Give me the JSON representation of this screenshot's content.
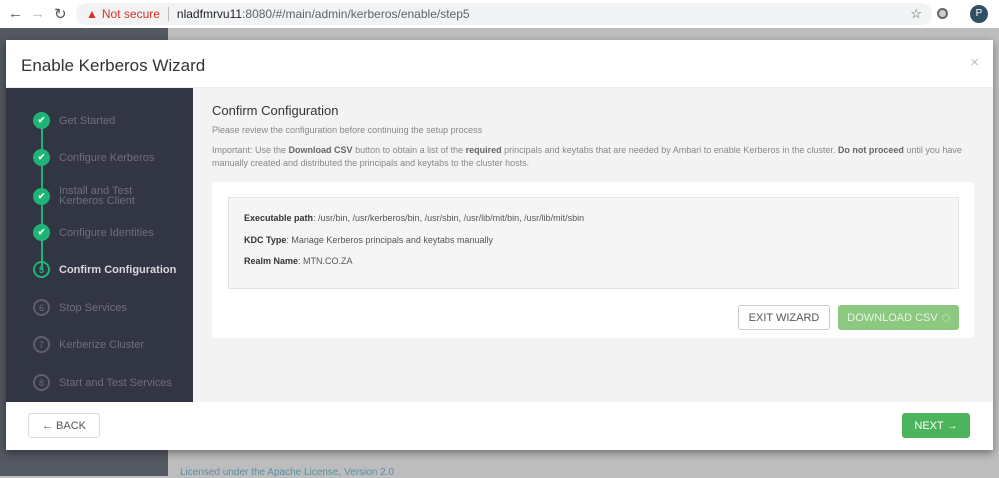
{
  "browser": {
    "back": "←",
    "forward": "→",
    "reload": "↻",
    "warning_icon": "▲",
    "not_secure": "Not secure",
    "url_host": "nladfmrvu11",
    "url_path": ":8080/#/main/admin/kerberos/enable/step5",
    "star": "☆",
    "profile": "P"
  },
  "background": {
    "license": "Licensed under the Apache License, Version 2.0"
  },
  "wizard": {
    "title": "Enable Kerberos Wizard",
    "close": "×",
    "steps": [
      {
        "num": "✔",
        "label": "Get Started",
        "state": "done"
      },
      {
        "num": "✔",
        "label": "Configure Kerberos",
        "state": "done"
      },
      {
        "num": "✔",
        "label": "Install and Test Kerberos Client",
        "state": "done"
      },
      {
        "num": "✔",
        "label": "Configure Identities",
        "state": "done"
      },
      {
        "num": "5",
        "label": "Confirm Configuration",
        "state": "current"
      },
      {
        "num": "6",
        "label": "Stop Services",
        "state": "todo"
      },
      {
        "num": "7",
        "label": "Kerberize Cluster",
        "state": "todo"
      },
      {
        "num": "8",
        "label": "Start and Test Services",
        "state": "todo"
      }
    ],
    "content": {
      "heading": "Confirm Configuration",
      "subtitle": "Please review the configuration before continuing the setup process",
      "imp": {
        "a": "Important: Use the ",
        "b": "Download CSV",
        "c": " button to obtain a list of the ",
        "d": "required",
        "e": " principals and keytabs that are needed by Ambari to enable Kerberos in the cluster. ",
        "f": "Do not proceed",
        "g": " until you have manually created and distributed the principals and keytabs to the cluster hosts."
      },
      "config": [
        {
          "key": "Executable path",
          "value": ": /usr/bin, /usr/kerberos/bin, /usr/sbin, /usr/lib/mit/bin, /usr/lib/mit/sbin"
        },
        {
          "key": "KDC Type",
          "value": ": Manage Kerberos principals and keytabs manually"
        },
        {
          "key": "Realm Name",
          "value": ": MTN.CO.ZA"
        }
      ],
      "exit_label": "EXIT WIZARD",
      "download_label": "DOWNLOAD CSV"
    },
    "back_label": "← BACK",
    "next_label": "NEXT →"
  },
  "colors": {
    "accent": "#1eb475",
    "next": "#4cb55c",
    "sidebar": "#323544"
  }
}
